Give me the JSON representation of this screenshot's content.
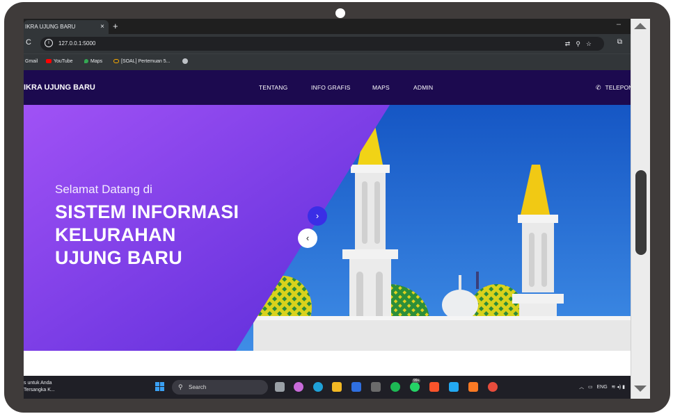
{
  "browser": {
    "tab_title": "IKRA UJUNG BARU",
    "tab_close": "×",
    "new_tab": "+",
    "minimize": "–",
    "reload": "C",
    "url": "127.0.0.1:5000",
    "bookmarks": [
      {
        "label": "Gmail",
        "icon": "gmail-icon",
        "color": "#ea4335"
      },
      {
        "label": "YouTube",
        "icon": "youtube-icon",
        "color": "#ff0000"
      },
      {
        "label": "Maps",
        "icon": "maps-icon",
        "color": "#34a853"
      },
      {
        "label": "[SOAL] Pertemuan 5...",
        "icon": "link-icon",
        "color": "#f9ab00"
      }
    ]
  },
  "site": {
    "brand": "IKRA UJUNG BARU",
    "nav": [
      "TENTANG",
      "INFO GRAFIS",
      "MAPS",
      "ADMIN"
    ],
    "phone": "TELEPON",
    "hero": {
      "welcome": "Selamat Datang di",
      "title_lines": [
        "SISTEM INFORMASI",
        "KELURAHAN",
        "UJUNG BARU"
      ],
      "next": "›",
      "prev": "‹"
    },
    "colors": {
      "navbar": "#1c0a4f",
      "accent": "#3a2ee6",
      "gradient_from": "#9b4cf2",
      "gradient_to": "#5a2bd8"
    }
  },
  "taskbar": {
    "weather_line1": "s untuk Anda",
    "weather_line2": "Tersangka K...",
    "search_placeholder": "Search",
    "badge": "99+",
    "lang": "ENG"
  }
}
